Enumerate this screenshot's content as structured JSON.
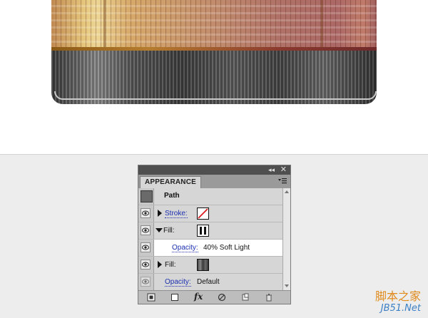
{
  "panel": {
    "tab_label": "APPEARANCE",
    "collapse_glyph": "◂◂",
    "close_glyph": "✕",
    "object_title": "Path",
    "rows": [
      {
        "kind": "stroke",
        "label": "Stroke:",
        "swatch": "none"
      },
      {
        "kind": "fill",
        "label": "Fill:",
        "swatch": "black-white-stripes",
        "expanded": true
      },
      {
        "kind": "opacity",
        "label": "Opacity:",
        "value": "40% Soft Light"
      },
      {
        "kind": "fill",
        "label": "Fill:",
        "swatch": "dark-gradient",
        "expanded": false
      },
      {
        "kind": "opacity",
        "label": "Opacity:",
        "value": "Default"
      }
    ],
    "bottom_toolbar": [
      "add-new-stroke-icon",
      "add-new-fill-icon",
      "add-new-effect-icon",
      "clear-appearance-icon",
      "duplicate-item-icon",
      "delete-item-icon"
    ],
    "fx_label": "fx"
  },
  "watermark": {
    "top": "脚本之家",
    "bottom": "JB51.Net"
  },
  "colors": {
    "link_blue": "#1a2fb0",
    "panel_bg": "#d6d6d6",
    "selected_row": "#ffffff"
  }
}
